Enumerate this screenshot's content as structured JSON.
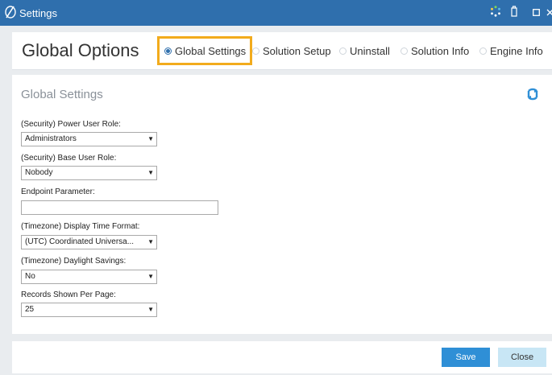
{
  "window": {
    "title": "Settings"
  },
  "header": {
    "title": "Global Options",
    "tabs": [
      {
        "label": "Global Settings",
        "selected": true
      },
      {
        "label": "Solution Setup",
        "selected": false
      },
      {
        "label": "Uninstall",
        "selected": false
      },
      {
        "label": "Solution Info",
        "selected": false
      },
      {
        "label": "Engine Info",
        "selected": false
      }
    ]
  },
  "section": {
    "title": "Global Settings",
    "fields": [
      {
        "label": "(Security) Power User Role:",
        "value": "Administrators",
        "type": "select"
      },
      {
        "label": "(Security) Base User Role:",
        "value": "Nobody",
        "type": "select"
      },
      {
        "label": "Endpoint Parameter:",
        "value": "",
        "type": "text"
      },
      {
        "label": "(Timezone) Display Time Format:",
        "value": "(UTC) Coordinated Universa...",
        "type": "select"
      },
      {
        "label": "(Timezone) Daylight Savings:",
        "value": "No",
        "type": "select"
      },
      {
        "label": "Records Shown Per Page:",
        "value": "25",
        "type": "select"
      }
    ]
  },
  "footer": {
    "save_label": "Save",
    "close_label": "Close"
  },
  "colors": {
    "titlebar": "#2f6fad",
    "highlight": "#f2ab1c",
    "save": "#2f8fd6",
    "close": "#c8e6f5"
  },
  "icons": {
    "app": "swirl-logo-icon",
    "refresh": "refresh-icon"
  }
}
